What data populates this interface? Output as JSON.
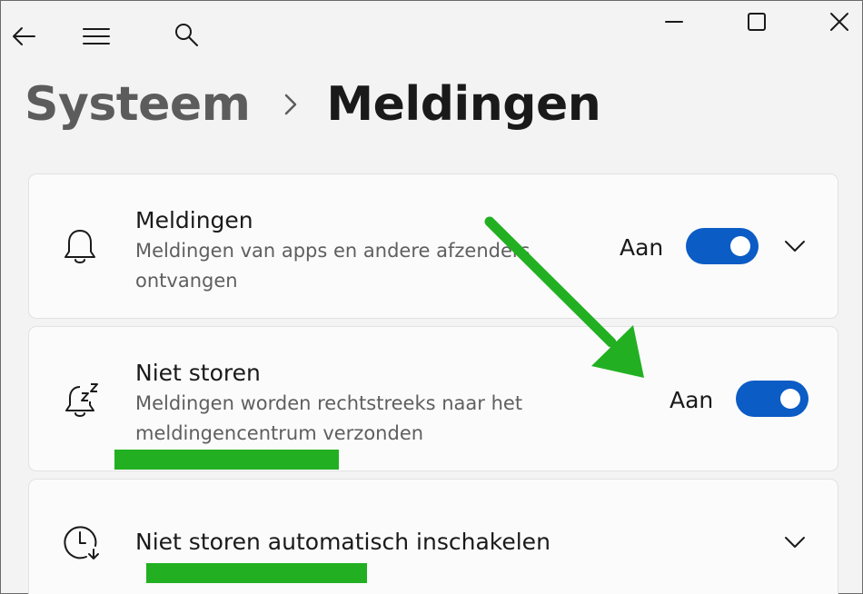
{
  "titlebar": {
    "back_icon": "arrow-left-icon",
    "menu_icon": "hamburger-icon",
    "search_icon": "search-icon",
    "minimize_icon": "minimize-icon",
    "maximize_icon": "maximize-icon",
    "close_icon": "close-icon"
  },
  "breadcrumb": {
    "parent": "Systeem",
    "separator_icon": "chevron-right-icon",
    "current": "Meldingen"
  },
  "settings": [
    {
      "title": "Meldingen",
      "description_line1": "Meldingen van apps en andere afzenders",
      "description_line2": "ontvangen",
      "state": "Aan",
      "toggle_on": true,
      "icon": "bell-icon",
      "expand_icon": "chevron-down-icon"
    },
    {
      "title": "Niet storen",
      "description_line1": "Meldingen worden rechtstreeks naar het",
      "description_line2": "meldingencentrum verzonden",
      "state": "Aan",
      "toggle_on": true,
      "icon": "bell-snooze-icon"
    },
    {
      "title": "Niet storen automatisch inschakelen",
      "icon": "clock-icon",
      "expand_icon": "chevron-down-icon"
    }
  ],
  "annotations": {
    "arrow_color": "#22b022",
    "highlight_color": "#22b022",
    "toggle_color": "#0b5cc5"
  }
}
